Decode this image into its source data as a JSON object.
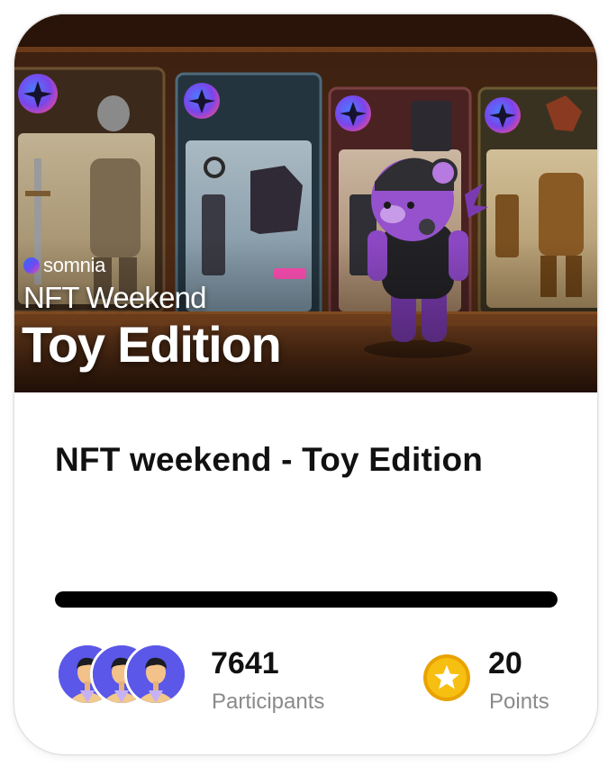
{
  "banner": {
    "brand": "somnia",
    "title_line1": "NFT Weekend",
    "title_line2": "Toy Edition"
  },
  "card": {
    "title": "NFT weekend - Toy Edition",
    "progress": 1.0
  },
  "stats": {
    "participants_count": "7641",
    "participants_label": "Participants",
    "points_value": "20",
    "points_label": "Points"
  },
  "icons": {
    "coin": "star-coin-icon",
    "avatar": "person-avatar-icon"
  },
  "colors": {
    "progress_fill": "#000000",
    "avatar_bg": "#5b57e8",
    "coin": "#f5b400"
  }
}
